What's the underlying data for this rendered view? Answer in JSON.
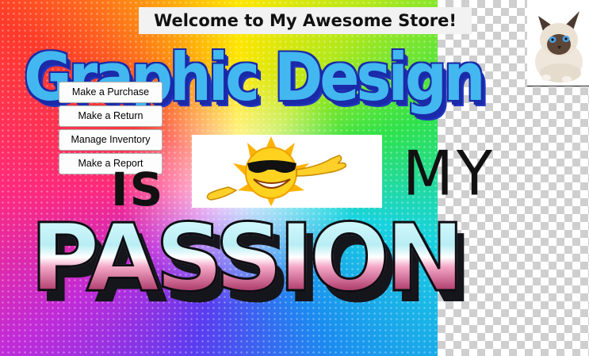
{
  "window": {
    "title": "Welcome to My Awesome Store!"
  },
  "artwork": {
    "line1": "Graphic Design",
    "line2_left": "IS",
    "line2_right": "MY",
    "line3": "PASSION",
    "sun_icon": "sunglasses-sun-icon",
    "cat_icon": "cat-photo"
  },
  "menu": {
    "buttons": [
      {
        "label": "Make a Purchase"
      },
      {
        "label": "Make a Return"
      },
      {
        "label": "Manage Inventory"
      },
      {
        "label": "Make a Report"
      }
    ]
  }
}
